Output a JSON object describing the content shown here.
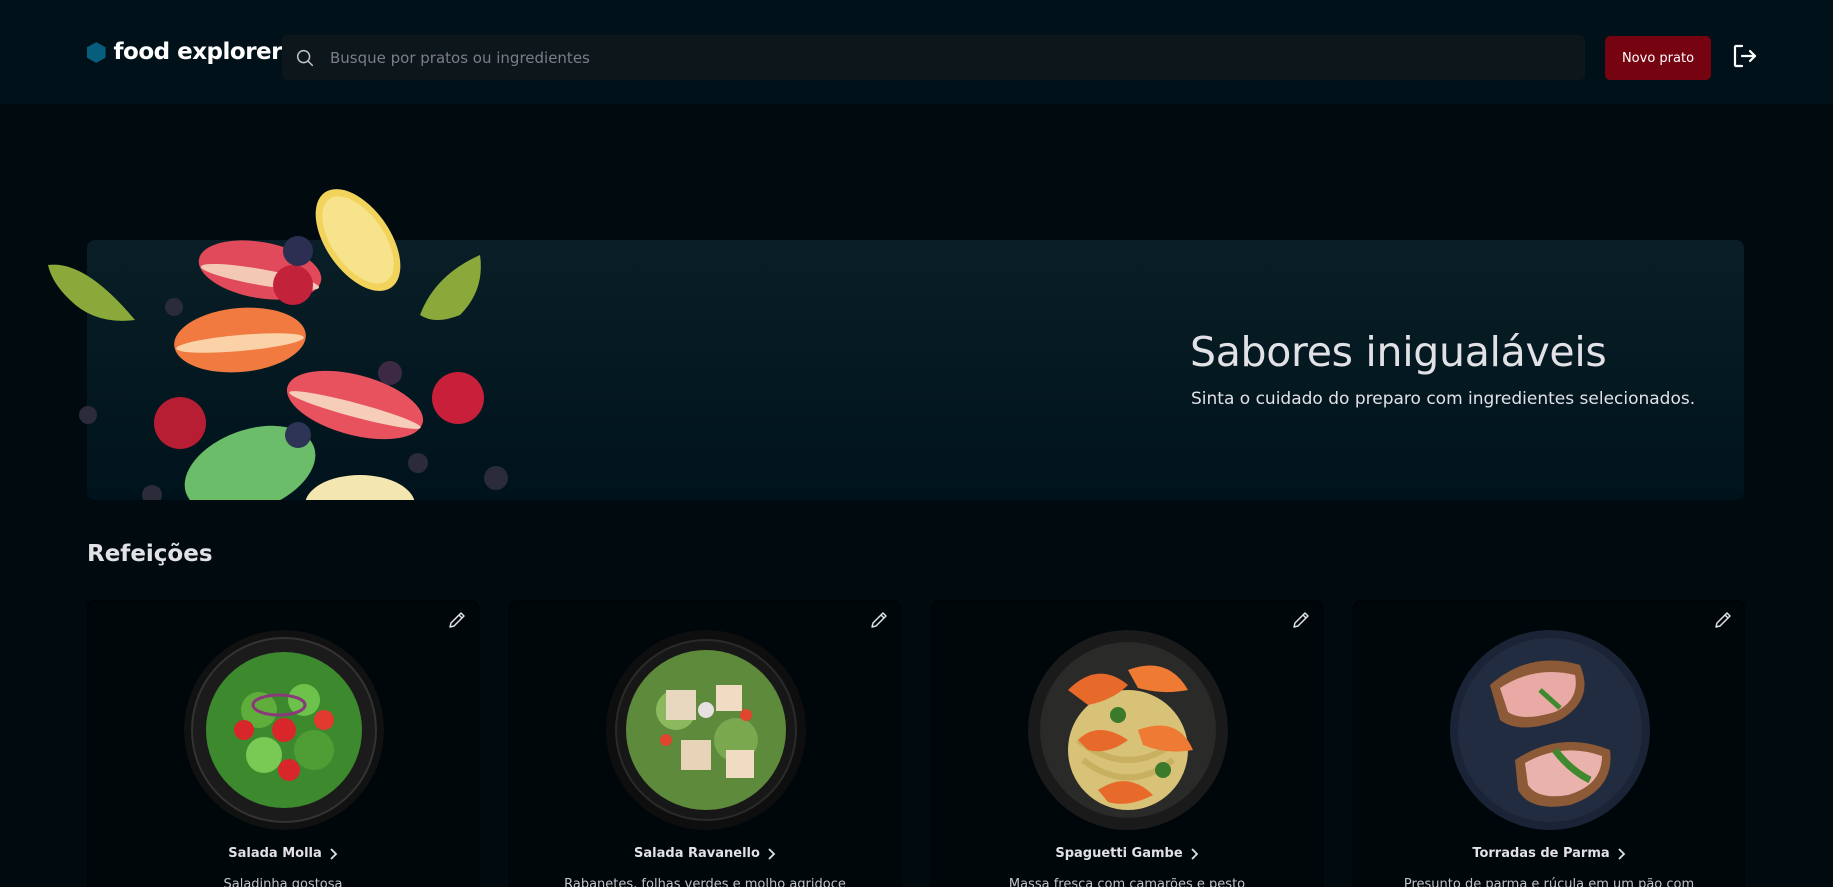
{
  "header": {
    "brand": "food explorer",
    "search_placeholder": "Busque por pratos ou ingredientes",
    "new_dish_label": "Novo prato"
  },
  "banner": {
    "title": "Sabores inigualáveis",
    "subtitle": "Sinta o cuidado do preparo com ingredientes selecionados."
  },
  "section": {
    "title": "Refeições"
  },
  "dishes": [
    {
      "name": "Salada Molla",
      "description": "Saladinha gostosa"
    },
    {
      "name": "Salada Ravanello",
      "description": "Rabanetes, folhas verdes e molho agridoce"
    },
    {
      "name": "Spaguetti Gambe",
      "description": "Massa fresca com camarões e pesto"
    },
    {
      "name": "Torradas de Parma",
      "description": "Presunto de parma e rúcula em um pão com"
    }
  ],
  "colors": {
    "header_bg": "#00111a",
    "page_bg": "#000a0f",
    "accent": "#750310",
    "brand_logo": "#065e7c"
  }
}
